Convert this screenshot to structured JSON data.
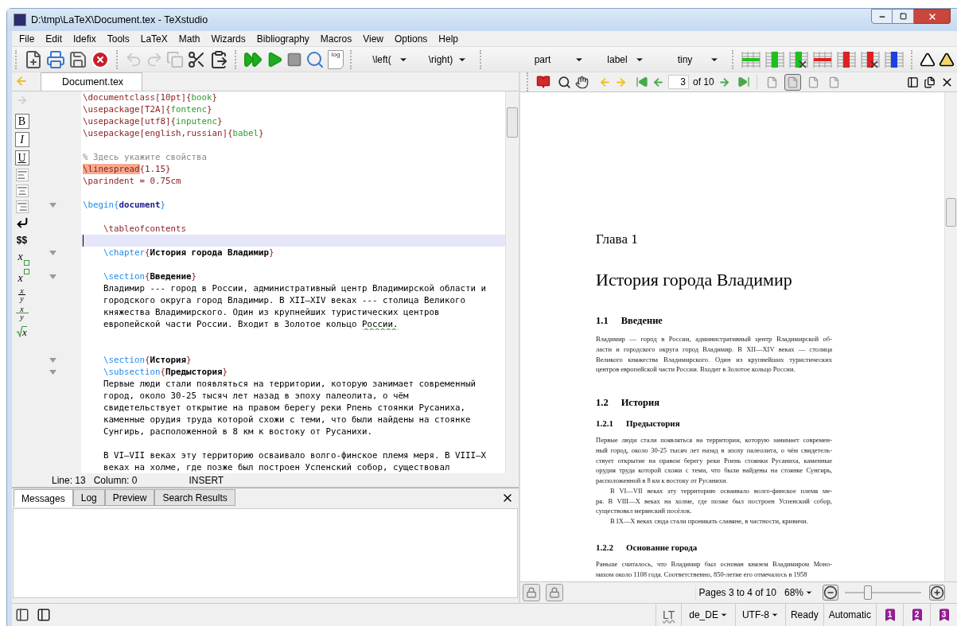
{
  "window": {
    "title": "D:\\tmp\\LaTeX\\Document.tex - TeXstudio"
  },
  "menu": [
    "File",
    "Edit",
    "Idefix",
    "Tools",
    "LaTeX",
    "Math",
    "Wizards",
    "Bibliography",
    "Macros",
    "View",
    "Options",
    "Help"
  ],
  "toolbar": {
    "log_label": "log",
    "math_dropdowns": [
      "\\left(",
      "\\right)"
    ],
    "structure_dropdowns": [
      "part",
      "label",
      "tiny"
    ]
  },
  "editor": {
    "tabs": [
      {
        "label": "Document.tex",
        "selected": true
      }
    ],
    "side_toolbar": [
      {
        "kind": "bold",
        "label": "B"
      },
      {
        "kind": "italic",
        "label": "I"
      },
      {
        "kind": "underline",
        "label": "U"
      },
      {
        "kind": "align_left"
      },
      {
        "kind": "align_center"
      },
      {
        "kind": "align_right"
      },
      {
        "kind": "newline"
      },
      {
        "kind": "dollars",
        "label": "$$"
      },
      {
        "kind": "subscript",
        "label": "x"
      },
      {
        "kind": "superscript",
        "label": "x"
      },
      {
        "kind": "fraction",
        "label": "x",
        "sublabel": "y"
      },
      {
        "kind": "dfrac",
        "label": "x",
        "sublabel": "y"
      },
      {
        "kind": "sqrt",
        "label": "x"
      }
    ],
    "lines": [
      {
        "fold": false,
        "current": false,
        "segments": [
          {
            "kind": "code",
            "text": "\\documentclass[10pt]{"
          },
          {
            "kind": "arg",
            "text": "book"
          },
          {
            "kind": "code",
            "text": "}"
          }
        ]
      },
      {
        "fold": false,
        "current": false,
        "segments": [
          {
            "kind": "code",
            "text": "\\usepackage[T2A]{"
          },
          {
            "kind": "arg",
            "text": "fontenc"
          },
          {
            "kind": "code",
            "text": "}"
          }
        ]
      },
      {
        "fold": false,
        "current": false,
        "segments": [
          {
            "kind": "code",
            "text": "\\usepackage[utf8]{"
          },
          {
            "kind": "arg",
            "text": "inputenc"
          },
          {
            "kind": "code",
            "text": "}"
          }
        ]
      },
      {
        "fold": false,
        "current": false,
        "segments": [
          {
            "kind": "code",
            "text": "\\usepackage[english,russian]{"
          },
          {
            "kind": "arg",
            "text": "babel"
          },
          {
            "kind": "code",
            "text": "}"
          }
        ]
      },
      {
        "fold": false,
        "current": false
      },
      {
        "fold": false,
        "current": false,
        "segments": [
          {
            "kind": "comment",
            "text": "% Здесь укажите свойства"
          }
        ]
      },
      {
        "fold": false,
        "current": false,
        "segments": [
          {
            "kind": "marked",
            "text": "\\linespread"
          },
          {
            "kind": "code",
            "text": "{1.15}"
          }
        ]
      },
      {
        "fold": false,
        "current": false,
        "segments": [
          {
            "kind": "code",
            "text": "\\parindent = 0.75cm"
          }
        ]
      },
      {
        "fold": false,
        "current": false
      },
      {
        "fold": true,
        "current": false,
        "segments": [
          {
            "kind": "structure",
            "text": "\\begin{"
          },
          {
            "kind": "keyword",
            "text": "document"
          },
          {
            "kind": "structure",
            "text": "}"
          }
        ]
      },
      {
        "fold": false,
        "current": false
      },
      {
        "fold": false,
        "current": false,
        "segments": [
          {
            "kind": "code",
            "text": "    \\tableofcontents"
          }
        ]
      },
      {
        "fold": false,
        "current": true
      },
      {
        "fold": true,
        "current": false,
        "segments": [
          {
            "kind": "structure",
            "text": "    \\chapter"
          },
          {
            "kind": "code",
            "text": "{"
          },
          {
            "kind": "heading",
            "text": "История города Владимир"
          },
          {
            "kind": "code",
            "text": "}"
          }
        ]
      },
      {
        "fold": false,
        "current": false
      },
      {
        "fold": true,
        "current": false,
        "segments": [
          {
            "kind": "structure",
            "text": "    \\section"
          },
          {
            "kind": "code",
            "text": "{"
          },
          {
            "kind": "heading",
            "text": "Введение"
          },
          {
            "kind": "code",
            "text": "}"
          }
        ]
      },
      {
        "fold": false,
        "current": false,
        "segments": [
          {
            "kind": "plain",
            "text": "    Владимир --- город в России, административный центр Владимирской области и"
          }
        ]
      },
      {
        "fold": false,
        "current": false,
        "segments": [
          {
            "kind": "plain",
            "text": "    городского округа город Владимир. В XII—XIV веках --- столица Великого"
          }
        ]
      },
      {
        "fold": false,
        "current": false,
        "segments": [
          {
            "kind": "plain",
            "text": "    княжества Владимирского. Один из крупнейших туристических центров"
          }
        ]
      },
      {
        "fold": false,
        "current": false,
        "segments": [
          {
            "kind": "plain",
            "text": "    европейской части России. Входит в Золотое кольцо "
          },
          {
            "kind": "misspelled",
            "text": "России."
          }
        ]
      },
      {
        "fold": false,
        "current": false
      },
      {
        "fold": false,
        "current": false
      },
      {
        "fold": true,
        "current": false,
        "segments": [
          {
            "kind": "structure",
            "text": "    \\section"
          },
          {
            "kind": "code",
            "text": "{"
          },
          {
            "kind": "heading",
            "text": "История"
          },
          {
            "kind": "code",
            "text": "}"
          }
        ]
      },
      {
        "fold": true,
        "current": false,
        "segments": [
          {
            "kind": "structure",
            "text": "    \\subsection"
          },
          {
            "kind": "code",
            "text": "{"
          },
          {
            "kind": "heading",
            "text": "Предыстория"
          },
          {
            "kind": "code",
            "text": "}"
          }
        ]
      },
      {
        "fold": false,
        "current": false,
        "segments": [
          {
            "kind": "plain",
            "text": "    Первые люди стали появляться на территории, которую занимает современный"
          }
        ]
      },
      {
        "fold": false,
        "current": false,
        "segments": [
          {
            "kind": "plain",
            "text": "    город, около 30-25 тысяч лет назад в эпоху палеолита, о чём"
          }
        ]
      },
      {
        "fold": false,
        "current": false,
        "segments": [
          {
            "kind": "plain",
            "text": "    свидетельствует открытие на правом берегу реки Рпень стоянки Русаниха,"
          }
        ]
      },
      {
        "fold": false,
        "current": false,
        "segments": [
          {
            "kind": "plain",
            "text": "    каменные орудия труда которой схожи с теми, что были найдены на стоянке"
          }
        ]
      },
      {
        "fold": false,
        "current": false,
        "segments": [
          {
            "kind": "plain",
            "text": "    Сунгирь, расположенной в 8 км к востоку от Русанихи."
          }
        ]
      },
      {
        "fold": false,
        "current": false
      },
      {
        "fold": false,
        "current": false,
        "segments": [
          {
            "kind": "plain",
            "text": "    В VI—VII веках эту территорию осваивало волго-финское племя меря. В VIII—X"
          }
        ]
      },
      {
        "fold": false,
        "current": false,
        "segments": [
          {
            "kind": "plain",
            "text": "    веках на холме, где позже был построен Успенский собор, существовал"
          }
        ]
      }
    ],
    "status": {
      "line": "Line: 13",
      "column": "Column: 0",
      "mode": "INSERT"
    }
  },
  "messages": {
    "tabs": [
      {
        "label": "Messages",
        "selected": true
      },
      {
        "label": "Log",
        "selected": false
      },
      {
        "label": "Preview",
        "selected": false
      },
      {
        "label": "Search Results",
        "selected": false
      }
    ]
  },
  "pdf": {
    "page_field": "3",
    "page_total": "of 10",
    "view_modes": [
      {
        "selected": false
      },
      {
        "selected": true
      },
      {
        "selected": false
      },
      {
        "selected": false
      }
    ],
    "blocks": [
      {
        "kind": "chapter_label",
        "text": "Глава 1"
      },
      {
        "kind": "chapter_title",
        "text": "История города Владимир"
      },
      {
        "kind": "section",
        "number": "1.1",
        "text": "Введение"
      },
      {
        "kind": "paragraph",
        "indented": false,
        "lines": [
          "Владимир — город в России, административный центр Владимирской об-",
          "ласти и городского округа город Владимир. В XII—XIV веках — столица",
          "Великого княжества Владимирского. Один из крупнейших туристических",
          "центров европейской части России. Входит в Золотое кольцо России."
        ]
      },
      {
        "kind": "section",
        "number": "1.2",
        "text": "История"
      },
      {
        "kind": "subsection",
        "number": "1.2.1",
        "text": "Предыстория"
      },
      {
        "kind": "paragraph",
        "indented": false,
        "lines": [
          "Первые люди стали появляться на территории, которую занимает современ-",
          "ный город, около 30-25 тысяч лет назад в эпоху палеолита, о чём свидетель-",
          "ствует открытие на правом берегу реки Рпень стоянки Русаниха, каменные",
          "орудия труда которой схожи с теми, что были найдены на стоянке Сунгирь,",
          "расположенной в 8 км к востоку от Русанихи."
        ]
      },
      {
        "kind": "paragraph",
        "indented": true,
        "lines": [
          "В VI—VII веках эту территорию осваивало волго-финское племя ме-",
          "ря. В VIII—X веках на холме, где позже был построен Успенский собор,",
          "существовал мерянский посёлок."
        ]
      },
      {
        "kind": "paragraph",
        "indented": true,
        "lines": [
          "В IX—X веках сюда стали проникать славяне, в частности, кривичи."
        ]
      },
      {
        "kind": "subsection",
        "number": "1.2.2",
        "text": "Основание города"
      },
      {
        "kind": "paragraph",
        "indented": false,
        "lines": [
          "Раньше считалось, что Владимир был основан князем Владимиром Моно-",
          "махом около 1108 года. Соответственно, 850-летие его отмечалось в 1958"
        ]
      }
    ],
    "pages": "Pages 3 to 4 of 10",
    "zoom": "68%",
    "zoom_slider": {
      "level": 0.3
    }
  },
  "status_bar": {
    "lt_label": "LT",
    "language": "de_DE",
    "encoding": "UTF-8",
    "state": "Ready",
    "compile_mode": "Automatic",
    "bookmarks": [
      "1",
      "2",
      "3"
    ]
  }
}
